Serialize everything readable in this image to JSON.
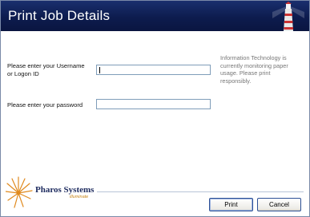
{
  "window": {
    "title": "Print Job Details"
  },
  "form": {
    "username_label_line1": "Please enter your Username",
    "username_label_line2": "or Logon ID",
    "username_value": "",
    "password_label": "Please enter your password",
    "password_value": ""
  },
  "notice": {
    "line1": "Information Technology is",
    "line2": "currently monitoring paper",
    "line3": "usage. Please print",
    "line4": "responsibly."
  },
  "branding": {
    "name": "Pharos Systems",
    "tagline": "illuminate"
  },
  "buttons": {
    "print_label": "Print",
    "cancel_label": "Cancel"
  },
  "icons": {
    "lighthouse": "lighthouse-icon",
    "logo": "sunburst-logo-icon"
  },
  "colors": {
    "titlebar": "#0d1c4e",
    "logo_orange": "#e08a1e",
    "logo_navy": "#1c2a5e"
  }
}
